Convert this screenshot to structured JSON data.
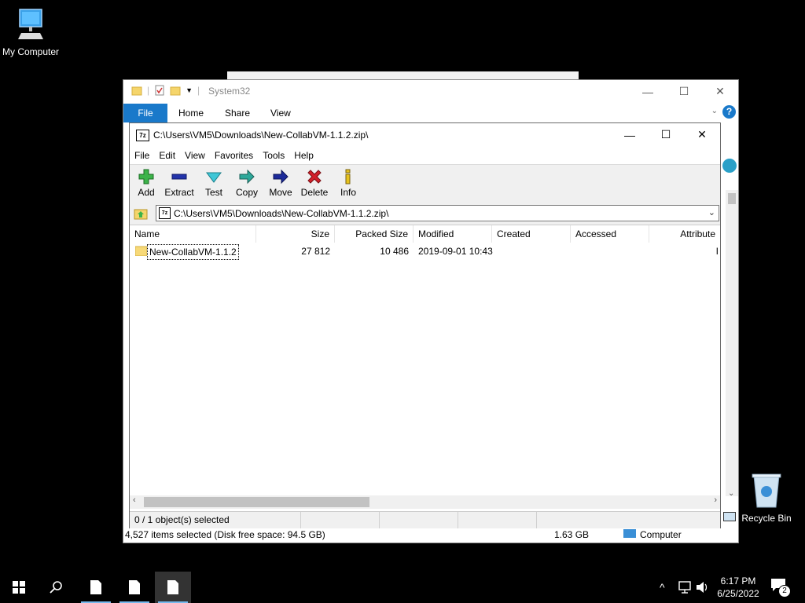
{
  "desktop": {
    "my_computer_label": "My Computer",
    "recycle_bin_label": "Recycle Bin"
  },
  "explorer": {
    "title": "System32",
    "tabs": [
      "File",
      "Home",
      "Share",
      "View"
    ],
    "status_text": "4,527 items selected (Disk free space: 94.5 GB)",
    "status_size": "1.63 GB",
    "status_location": "Computer"
  },
  "zip": {
    "title": "C:\\Users\\VM5\\Downloads\\New-CollabVM-1.1.2.zip\\",
    "app_icon_text": "7z",
    "menu": [
      "File",
      "Edit",
      "View",
      "Favorites",
      "Tools",
      "Help"
    ],
    "toolbar": [
      "Add",
      "Extract",
      "Test",
      "Copy",
      "Move",
      "Delete",
      "Info"
    ],
    "address": "C:\\Users\\VM5\\Downloads\\New-CollabVM-1.1.2.zip\\",
    "columns": [
      "Name",
      "Size",
      "Packed Size",
      "Modified",
      "Created",
      "Accessed",
      "Attribute"
    ],
    "rows": [
      {
        "name": "New-CollabVM-1.1.2",
        "size": "27 812",
        "packed": "10 486",
        "modified": "2019-09-01 10:43",
        "created": "",
        "accessed": "",
        "attr": "I"
      }
    ],
    "status": "0 / 1 object(s) selected"
  },
  "taskbar": {
    "time": "6:17 PM",
    "date": "6/25/2022",
    "notification_count": "2"
  },
  "colors": {
    "accent": "#1979ca",
    "taskbar_highlight": "#76b9ed"
  }
}
